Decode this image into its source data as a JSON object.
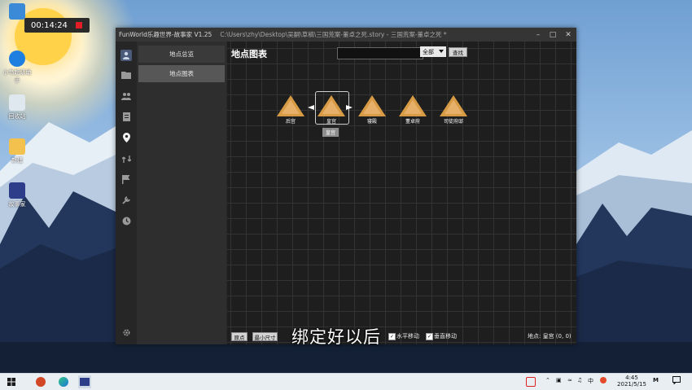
{
  "recorder": {
    "time": "00:14:24"
  },
  "desktop_icons": [
    {
      "label": "",
      "icon": "computer-icon"
    },
    {
      "label": "小鸟超级助手",
      "icon": "software-icon"
    },
    {
      "label": "回收站",
      "icon": "recycle-bin-icon"
    },
    {
      "label": "新建",
      "icon": "folder-icon"
    },
    {
      "label": "故事家",
      "icon": "storyteller-app-icon"
    }
  ],
  "window": {
    "app_title": "FunWorld乐趣世界-故事家 V1.25",
    "file_path": "C:\\Users\\zhy\\Desktop\\吴嗣\\草稿\\三国荒案-董卓之死.story - 三国荒案-董卓之死 *",
    "controls": [
      "minimize-icon",
      "maximize-icon",
      "close-icon"
    ]
  },
  "nav_icons": [
    "person-icon",
    "folder-icon",
    "group-icon",
    "document-icon",
    "location-pin-icon",
    "route-icon",
    "flag-icon",
    "tools-icon",
    "clock-icon",
    "settings-icon"
  ],
  "side_panel": {
    "items": [
      {
        "label": "地点总览",
        "active": false
      },
      {
        "label": "地点图表",
        "active": true
      }
    ]
  },
  "main": {
    "title": "地点图表",
    "search": {
      "value": "",
      "placeholder": ""
    },
    "filter": {
      "selected": "全部"
    },
    "find_button": "查找",
    "locations": [
      {
        "label": "后宫",
        "selected": false
      },
      {
        "label": "皇宫",
        "selected": true
      },
      {
        "label": "寝殿",
        "selected": false
      },
      {
        "label": "董卓府",
        "selected": false
      },
      {
        "label": "司徒府邸",
        "selected": false
      }
    ],
    "tooltip": "皇宫",
    "bottom": {
      "reset_button": "原点",
      "min_size_button": "最小尺寸",
      "horizontal_move": "水平移动",
      "vertical_move": "垂直移动",
      "status": "地点: 皇宫 (0, 0)"
    }
  },
  "subtitle": "绑定好以后",
  "taskbar": {
    "apps": [
      "windows-start-icon",
      "powerpoint-icon",
      "edge-icon",
      "storyteller-app-icon"
    ],
    "clock_time": "4:45",
    "clock_date": "2021/5/15",
    "tray_text": "中"
  },
  "colors": {
    "location_marker": "#d79b45",
    "window_bg": "#2a2a2a",
    "grid_bg": "#1e1e1e"
  }
}
